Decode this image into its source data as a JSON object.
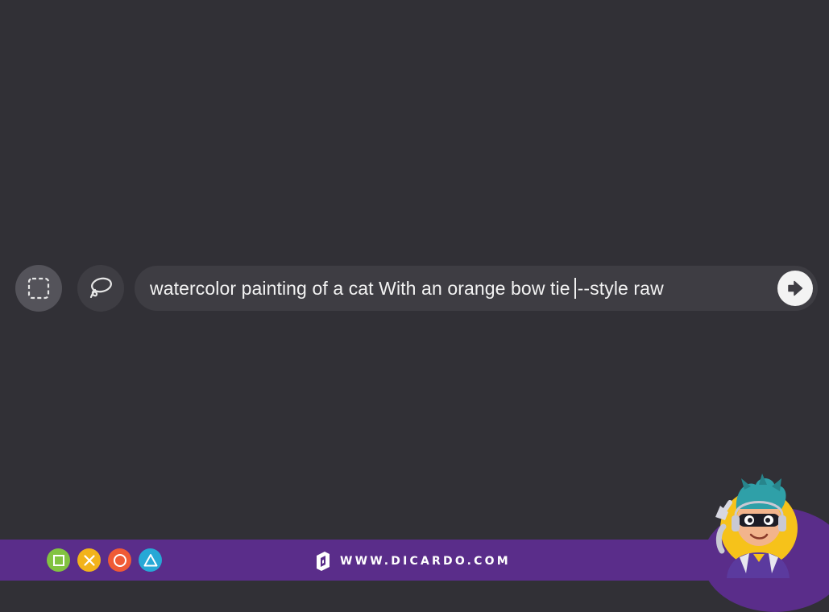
{
  "toolbar": {
    "tools": [
      {
        "id": "rectangle-select",
        "icon": "dashed-rectangle-icon",
        "active": true
      },
      {
        "id": "lasso-select",
        "icon": "lasso-icon",
        "active": false
      }
    ]
  },
  "prompt": {
    "text_before_caret": "watercolor painting of a cat With an orange bow tie",
    "text_after_caret": "--style raw",
    "submit_icon": "arrow-right-icon"
  },
  "footer": {
    "controls": [
      {
        "icon": "square-icon",
        "color": "#82c341"
      },
      {
        "icon": "cross-icon",
        "color": "#f2b31b"
      },
      {
        "icon": "circle-icon",
        "color": "#ef5a35"
      },
      {
        "icon": "triangle-icon",
        "color": "#27a8d6"
      }
    ],
    "site": "WWW.DICARDO.COM",
    "band_color": "#5a2d8a"
  },
  "colors": {
    "background": "#313036",
    "bar": "#3e3d43",
    "active_tool": "#54535a"
  }
}
